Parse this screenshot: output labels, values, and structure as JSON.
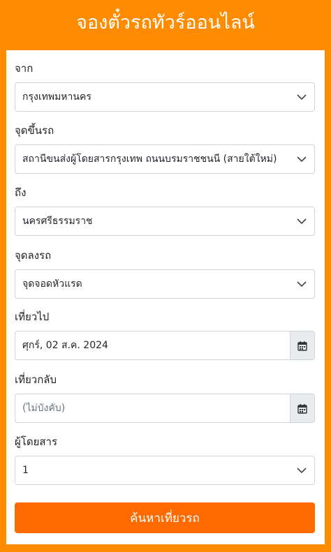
{
  "header": {
    "title": "จองตั๋วรถทัวร์ออนไลน์"
  },
  "form": {
    "origin": {
      "label": "จาก",
      "value": "กรุงเทพมหานคร"
    },
    "pickup": {
      "label": "จุดขึ้นรถ",
      "value": "สถานีขนส่งผู้โดยสารกรุงเทพ ถนนบรมราชชนนี (สายใต้ใหม่)"
    },
    "destination": {
      "label": "ถึง",
      "value": "นครศรีธรรมราช"
    },
    "dropoff": {
      "label": "จุดลงรถ",
      "value": "จุดจอดหัวแรด"
    },
    "departure": {
      "label": "เที่ยวไป",
      "value": "ศุกร์, 02 ส.ค. 2024"
    },
    "return": {
      "label": "เที่ยวกลับ",
      "placeholder": "(ไม่บังคับ)"
    },
    "passengers": {
      "label": "ผู้โดยสาร",
      "value": "1"
    },
    "search_label": "ค้นหาเที่ยวรถ"
  },
  "icons": {
    "dropdown": "chevron-down-icon",
    "calendar": "calendar-icon"
  },
  "colors": {
    "page_background": "#ff8c00",
    "button": "#ff6a00"
  }
}
